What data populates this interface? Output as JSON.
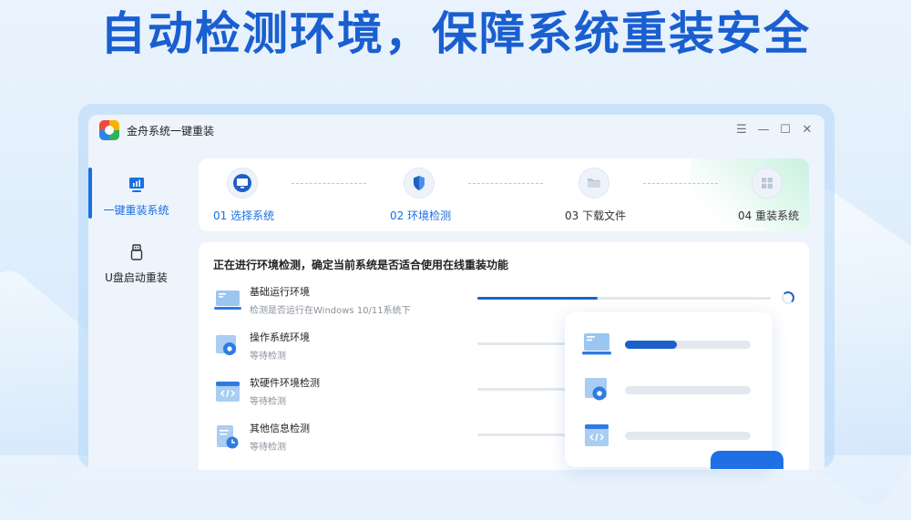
{
  "headline": "自动检测环境，保障系统重装安全",
  "window": {
    "title": "金舟系统一键重装",
    "controls": [
      "menu-icon",
      "minimize-icon",
      "maximize-icon",
      "close-icon"
    ]
  },
  "sidebar": {
    "items": [
      {
        "label": "一键重装系统",
        "icon": "monitor-chart-icon",
        "active": true
      },
      {
        "label": "U盘启动重装",
        "icon": "usb-drive-icon",
        "active": false
      }
    ]
  },
  "steps": [
    {
      "label": "01 选择系统",
      "icon": "monitor-icon",
      "state": "done"
    },
    {
      "label": "02 环境检测",
      "icon": "shield-icon",
      "state": "active"
    },
    {
      "label": "03 下载文件",
      "icon": "folder-icon",
      "state": "pending"
    },
    {
      "label": "04 重装系统",
      "icon": "windows-grid-icon",
      "state": "pending"
    }
  ],
  "check": {
    "title": "正在进行环境检测，确定当前系统是否适合使用在线重装功能",
    "rows": [
      {
        "name": "基础运行环境",
        "status": "检测是否运行在Windows 10/11系统下",
        "progress": 0.41,
        "icon": "laptop-icon"
      },
      {
        "name": "操作系统环境",
        "status": "等待检测",
        "progress": 0,
        "icon": "os-settings-icon"
      },
      {
        "name": "软硬件环境检测",
        "status": "等待检测",
        "progress": 0,
        "icon": "code-window-icon"
      },
      {
        "name": "其他信息检测",
        "status": "等待检测",
        "progress": 0,
        "icon": "document-clock-icon"
      }
    ]
  },
  "float_card": {
    "rows": [
      {
        "icon": "laptop-icon",
        "progress": 0.41
      },
      {
        "icon": "os-settings-icon",
        "progress": 0
      },
      {
        "icon": "code-window-icon",
        "progress": 0
      }
    ]
  },
  "colors": {
    "accent": "#1a6fe0",
    "headline": "#1a5fd0",
    "progress": "#1e63cc"
  }
}
